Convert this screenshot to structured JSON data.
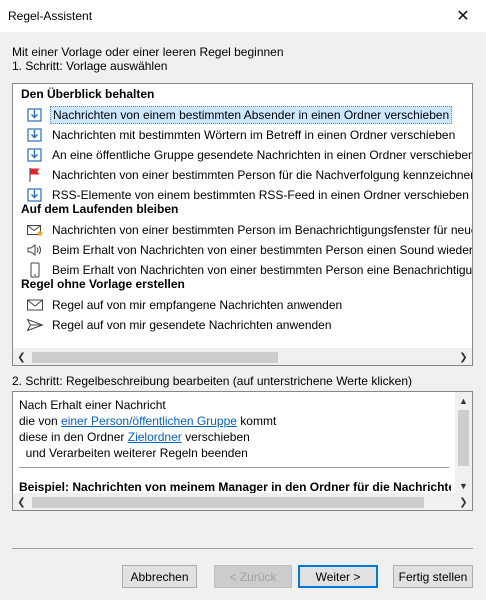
{
  "window": {
    "title": "Regel-Assistent",
    "close_glyph": "✕"
  },
  "intro": {
    "line1": "Mit einer Vorlage oder einer leeren Regel beginnen",
    "line2": "1. Schritt: Vorlage auswählen"
  },
  "templates": {
    "group1": "Den Überblick behalten",
    "group1_items": [
      {
        "label": "Nachrichten von einem bestimmten Absender in einen Ordner verschieben",
        "icon": "move-to-folder-icon",
        "selected": true
      },
      {
        "label": "Nachrichten mit bestimmten Wörtern im Betreff in einen Ordner verschieben",
        "icon": "move-to-folder-icon"
      },
      {
        "label": "An eine öffentliche Gruppe gesendete Nachrichten in einen Ordner verschieben",
        "icon": "move-to-folder-icon"
      },
      {
        "label": "Nachrichten von einer bestimmten Person für die Nachverfolgung kennzeichnen",
        "icon": "red-flag-icon"
      },
      {
        "label": "RSS-Elemente von einem bestimmten RSS-Feed in einen Ordner verschieben",
        "icon": "move-to-folder-icon"
      }
    ],
    "group2": "Auf dem Laufenden bleiben",
    "group2_items": [
      {
        "label": "Nachrichten von einer bestimmten Person im Benachrichtigungsfenster für neue Elemente anzeigen",
        "icon": "envelope-star-icon"
      },
      {
        "label": "Beim Erhalt von Nachrichten von einer bestimmten Person einen Sound wiedergeben",
        "icon": "speaker-icon"
      },
      {
        "label": "Beim Erhalt von Nachrichten von einer bestimmten Person eine Benachrichtigung an mein Mobilgerät senden",
        "icon": "mobile-phone-icon"
      }
    ],
    "group3": "Regel ohne Vorlage erstellen",
    "group3_items": [
      {
        "label": "Regel auf von mir empfangene Nachrichten anwenden",
        "icon": "envelope-icon"
      },
      {
        "label": "Regel auf von mir gesendete Nachrichten anwenden",
        "icon": "send-icon"
      }
    ]
  },
  "step2": {
    "label": "2. Schritt: Regelbeschreibung bearbeiten (auf unterstrichene Werte klicken)",
    "l1": "Nach Erhalt einer Nachricht",
    "l2_pre": "die von ",
    "l2_link": "einer Person/öffentlichen Gruppe",
    "l2_post": " kommt",
    "l3_pre": "diese in den Ordner ",
    "l3_link": "Zielordner",
    "l3_post": " verschieben",
    "l4": "  und Verarbeiten weiterer Regeln beenden",
    "example": "Beispiel: Nachrichten von meinem Manager in den Ordner für die Nachrichten mit hoher Priorität verschieben"
  },
  "buttons": {
    "cancel": "Abbrechen",
    "back": "< Zurück",
    "next": "Weiter >",
    "finish": "Fertig stellen"
  },
  "colors": {
    "selection": "#cce8ff",
    "link": "#0563c1",
    "default_button_border": "#0078d7"
  }
}
